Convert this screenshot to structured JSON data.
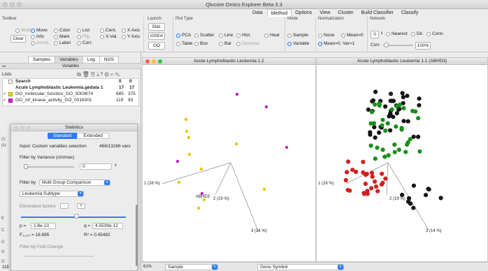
{
  "window": {
    "title": "Qlucore Omics Explorer Beta 3.3"
  },
  "menu": {
    "tabs": [
      "Data",
      "Method",
      "Options",
      "View",
      "Cluster",
      "Build Classifier",
      "Classify"
    ],
    "active": "Method"
  },
  "toolbox": {
    "label": "Toolbox",
    "mode_col1": [
      "Multi",
      "Info",
      "Annot."
    ],
    "mode_col2": [
      "Move",
      "Mark",
      "Label"
    ],
    "mode_col3": [
      "Color",
      "Flip",
      "Corr."
    ],
    "mode_col4": [
      "List",
      "X-Val."
    ],
    "mode_col5": [
      "Cent.",
      "Y Axis"
    ],
    "mode_col6": [
      "X Axis"
    ],
    "clear_label": "Clear"
  },
  "launch": {
    "label": "Launch",
    "buttons": [
      "Stat.",
      "GSEA",
      "GO"
    ]
  },
  "plot_type": {
    "label": "Plot Type",
    "row1": [
      "PCA",
      "Scatter",
      "Line",
      "Hist.",
      "Heat"
    ],
    "row2": [
      "Table",
      "Box",
      "Bar",
      "Genome"
    ]
  },
  "mode": {
    "label": "Mode",
    "options": [
      "Sample",
      "Variable"
    ]
  },
  "normalization": {
    "label": "Normalization",
    "options": [
      "None",
      "Mean=0",
      "Mean=0, Var=1"
    ]
  },
  "network": {
    "label": "Network",
    "spin_value": "0",
    "options": [
      "Nearest",
      "Dir.",
      "Conn."
    ],
    "corr_label": "Corr.",
    "corr_value": "100%"
  },
  "left": {
    "tabs": [
      "Samples",
      "Variables",
      "Log",
      "NGS"
    ],
    "active_tab": "Variables",
    "variables_header": "Variables",
    "lists_label": "Lists",
    "rows": [
      {
        "name": "Search",
        "a": "0",
        "b": "0",
        "bold": true
      },
      {
        "name": "Acute Lymphoblastic Leukemia.gedata 1",
        "a": "17",
        "b": "17",
        "bold": true
      },
      {
        "name": "GO_molecular_function_GO_0003674",
        "a": "685",
        "b": "375",
        "bold": false
      },
      {
        "name": "GO_mf_kinase_activity_GO_0016301",
        "a": "119",
        "b": "93",
        "bold": false
      }
    ],
    "side_letters": [
      "Cl",
      "Gr",
      "E",
      "C",
      "G",
      "G",
      "G"
    ],
    "bottom_count": "118"
  },
  "stats": {
    "title": "Statistics",
    "tabs": [
      "Standard",
      "Extended"
    ],
    "input_text": "Input: Custom variables selection",
    "input_count": "466/13266 vars",
    "filter_variance": "Filter by Variance (σ/σmax)",
    "variance_value": "0",
    "filter_by": "Filter by",
    "comparison": "Multi Group Comparison",
    "subtype": "Leukemia Subtype",
    "eliminated": "Eliminated factors",
    "p_label": "p =",
    "p_value": "1.8e-13",
    "q_label": "q =",
    "q_value": "4.5539e-12",
    "f_text": "F₁,₁₇₀ = 18.695",
    "r2_text": "R² = 0.45492",
    "fold_change": "Filter by Fold Change"
  },
  "plot1": {
    "title": "Acute Lymphoblastic Leukemia 1.2",
    "axis1": "1 (28 %)",
    "axis2": "2 (19 %)",
    "axis3": "3 (14 %)",
    "label": "ABHD3"
  },
  "plot2": {
    "title": "Acute Lymphoblastic Leukemia 1.1 (ABHD3)",
    "axis1": "1 (28 %)",
    "axis2": "2 (19 %)",
    "axis3": "3 (14 %)"
  },
  "bottom": {
    "zoom": "61%",
    "select1": "Sample",
    "select2": "Gene Symbol"
  },
  "colors": {
    "accent": "#1a78f0",
    "yellow": "#e8c400",
    "magenta": "#c21fc2",
    "red": "#d21f1f",
    "green": "#1a8f1a",
    "black": "#151515"
  }
}
